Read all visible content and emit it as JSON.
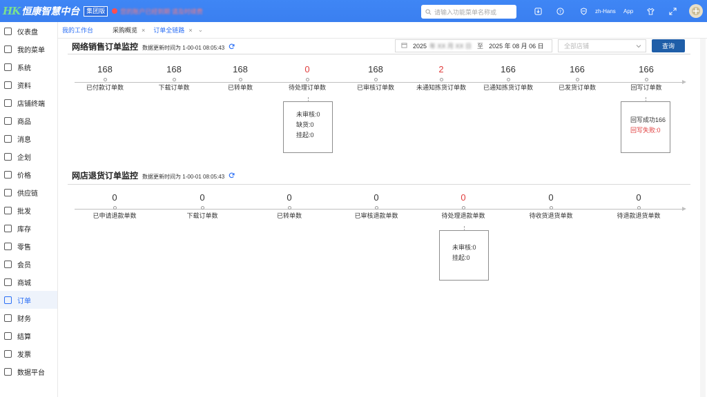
{
  "topbar": {
    "logo_mark": "HK",
    "logo_text": "恒康智慧中台",
    "edition": "集团版",
    "warning_text": "您的账户已经到期 请及时续费",
    "search_placeholder": "请输入功能菜单名称或",
    "icons": [
      "download-icon",
      "help-icon",
      "shield-icon",
      "translate-icon",
      "shirt-icon",
      "fullscreen-icon"
    ],
    "lang": "zh-Hans",
    "app_label": "App"
  },
  "sidebar": {
    "items": [
      {
        "label": "仪表盘",
        "icon": "dashboard-icon"
      },
      {
        "label": "我的菜单",
        "icon": "grid-icon"
      },
      {
        "label": "系统",
        "icon": "monitor-icon"
      },
      {
        "label": "资料",
        "icon": "document-icon"
      },
      {
        "label": "店铺终端",
        "icon": "store-icon"
      },
      {
        "label": "商品",
        "icon": "box-icon"
      },
      {
        "label": "消息",
        "icon": "message-icon"
      },
      {
        "label": "企划",
        "icon": "plan-icon"
      },
      {
        "label": "价格",
        "icon": "price-icon"
      },
      {
        "label": "供应链",
        "icon": "supply-icon"
      },
      {
        "label": "批发",
        "icon": "wholesale-icon"
      },
      {
        "label": "库存",
        "icon": "warehouse-icon"
      },
      {
        "label": "零售",
        "icon": "retail-icon"
      },
      {
        "label": "会员",
        "icon": "member-icon"
      },
      {
        "label": "商城",
        "icon": "cart-icon"
      },
      {
        "label": "订单",
        "icon": "order-icon",
        "active": true
      },
      {
        "label": "财务",
        "icon": "finance-icon"
      },
      {
        "label": "结算",
        "icon": "settle-icon"
      },
      {
        "label": "发票",
        "icon": "invoice-icon"
      },
      {
        "label": "数据平台",
        "icon": "database-icon"
      }
    ]
  },
  "tabs": {
    "home": "我的工作台",
    "items": [
      {
        "label": "采购概览",
        "closable": true
      },
      {
        "label": "订单全链路",
        "closable": true,
        "active": true
      }
    ],
    "close_glyph": "×",
    "more_glyph": "⌄"
  },
  "filters": {
    "year": "2025",
    "start_date_blurred": "年 XX 月 XX 日",
    "separator": "至",
    "end_date": "2025 年 08 月 06 日",
    "store_placeholder": "全部店铺",
    "query_button": "查询"
  },
  "sales_monitor": {
    "title": "网络销售订单监控",
    "update_text": "数据更新时间为 1-00-01 08:05:43",
    "nodes": [
      {
        "value": "168",
        "label": "已付款订单数"
      },
      {
        "value": "168",
        "label": "下载订单数"
      },
      {
        "value": "168",
        "label": "已转单数"
      },
      {
        "value": "0",
        "label": "待处理订单数",
        "highlight": true
      },
      {
        "value": "168",
        "label": "已审核订单数"
      },
      {
        "value": "2",
        "label": "未通知拣货订单数",
        "highlight": true
      },
      {
        "value": "166",
        "label": "已通知拣货订单数"
      },
      {
        "value": "166",
        "label": "已发货订单数"
      },
      {
        "value": "166",
        "label": "回写订单数"
      }
    ],
    "pending_box": [
      "未审核:0",
      "缺货:0",
      "挂起:0"
    ],
    "writeback_box": {
      "success": "回写成功166",
      "fail": "回写失败:0"
    }
  },
  "return_monitor": {
    "title": "网店退货订单监控",
    "update_text": "数据更新时间为 1-00-01 08:05:43",
    "nodes": [
      {
        "value": "0",
        "label": "已申请退款单数"
      },
      {
        "value": "0",
        "label": "下载订单数"
      },
      {
        "value": "0",
        "label": "已转单数"
      },
      {
        "value": "0",
        "label": "已审核退款单数"
      },
      {
        "value": "0",
        "label": "待处理退款单数",
        "highlight": true
      },
      {
        "value": "0",
        "label": "待收货退货单数"
      },
      {
        "value": "0",
        "label": "待退款退货单数"
      }
    ],
    "pending_box": [
      "未审核:0",
      "挂起:0"
    ]
  }
}
